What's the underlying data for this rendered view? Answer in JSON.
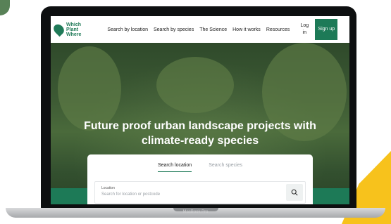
{
  "device": {
    "label": "MacBook Pro"
  },
  "nav": {
    "logo_text": [
      "Which",
      "Plant",
      "Where"
    ],
    "links": [
      "Search by location",
      "Search by species",
      "The Science",
      "How it works",
      "Resources"
    ],
    "login": "Log in",
    "signup": "Sign up"
  },
  "hero": {
    "title_line1": "Future proof urban landscape projects with",
    "title_line2": "climate-ready species"
  },
  "search": {
    "tabs": [
      "Search location",
      "Search species"
    ],
    "active_tab": "Search location",
    "field_label": "Location",
    "placeholder": "Search for location or postcode"
  },
  "colors": {
    "brand_green": "#1d7a57",
    "accent_yellow": "#f7c21c"
  }
}
